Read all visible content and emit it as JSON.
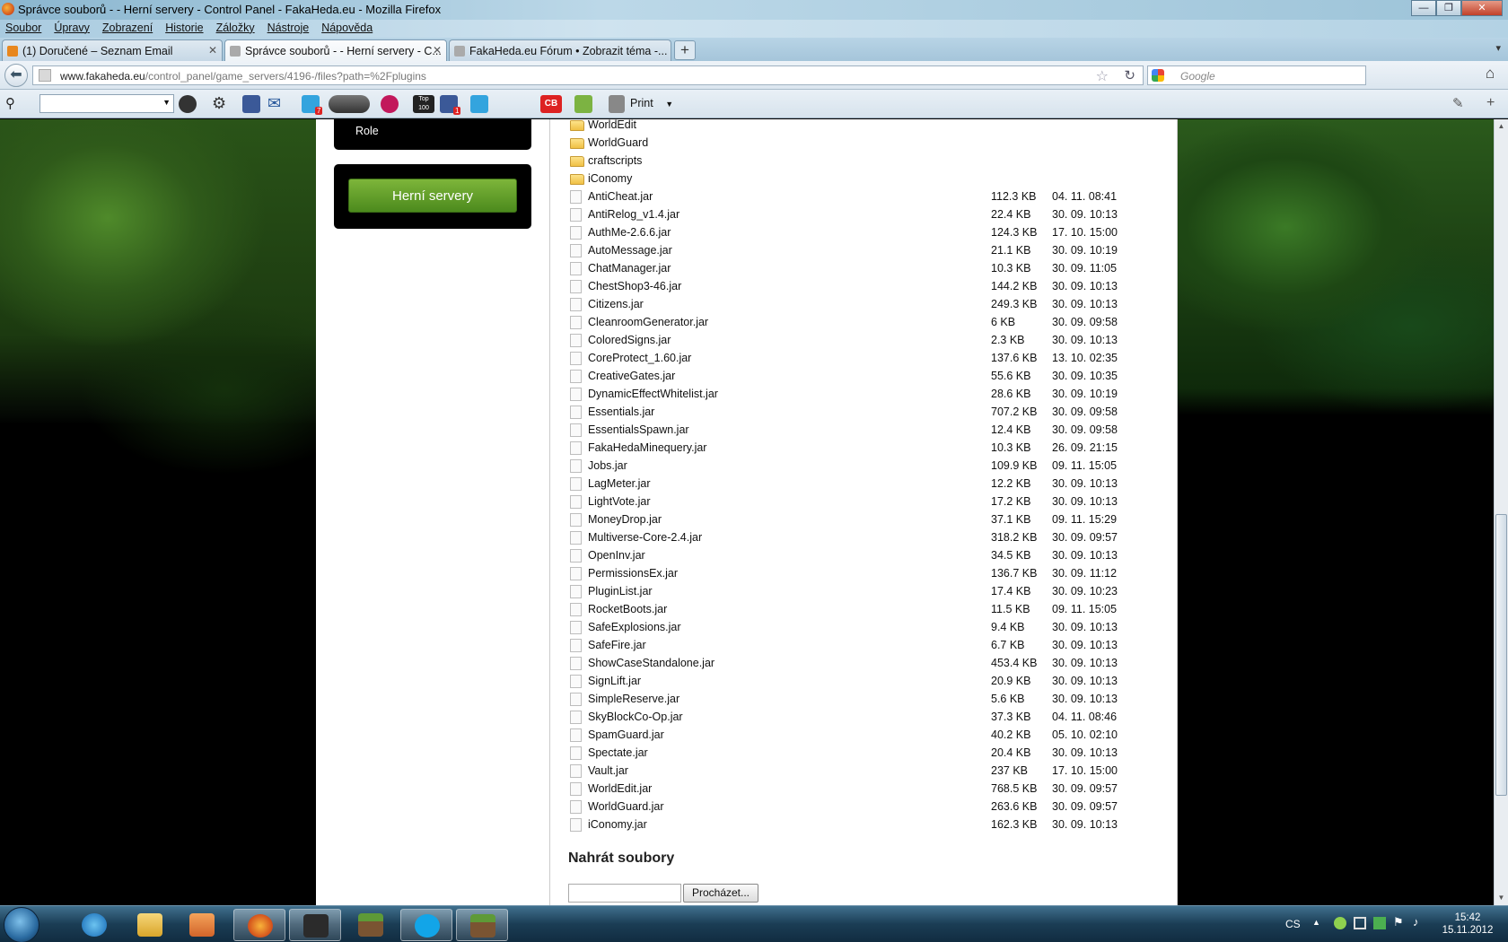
{
  "window": {
    "title": "Správce souborů - - Herní servery - Control Panel - FakaHeda.eu - Mozilla Firefox",
    "buttons": {
      "minimize": "—",
      "maximize": "❐",
      "close": "✕"
    }
  },
  "menu": [
    "Soubor",
    "Úpravy",
    "Zobrazení",
    "Historie",
    "Záložky",
    "Nástroje",
    "Nápověda"
  ],
  "tabs": [
    {
      "label": "(1) Doručené – Seznam Email",
      "active": false
    },
    {
      "label": "Správce souborů - - Herní servery - C...",
      "active": true
    },
    {
      "label": "FakaHeda.eu Fórum • Zobrazit téma -...",
      "active": false
    }
  ],
  "tabs_new": "+",
  "tabs_list": "▾",
  "nav": {
    "url_host": "www.fakaheda.eu",
    "url_path": "/control_panel/game_servers/4196-/files?path=%2Fplugins",
    "search_placeholder": "Google",
    "back": "⬅"
  },
  "toolbar2": {
    "print_label": "Print",
    "badges": {
      "twitter": "7",
      "top": "Top 100",
      "facebook": "1"
    }
  },
  "sidebar": {
    "role_label": "Role",
    "game_servers_button": "Herní servery"
  },
  "files": {
    "folders": [
      "WorldEdit",
      "WorldGuard",
      "craftscripts",
      "iConomy"
    ],
    "items": [
      {
        "name": "AntiCheat.jar",
        "size": "112.3 KB",
        "date": "04. 11. 08:41"
      },
      {
        "name": "AntiRelog_v1.4.jar",
        "size": "22.4 KB",
        "date": "30. 09. 10:13"
      },
      {
        "name": "AuthMe-2.6.6.jar",
        "size": "124.3 KB",
        "date": "17. 10. 15:00"
      },
      {
        "name": "AutoMessage.jar",
        "size": "21.1 KB",
        "date": "30. 09. 10:19"
      },
      {
        "name": "ChatManager.jar",
        "size": "10.3 KB",
        "date": "30. 09. 11:05"
      },
      {
        "name": "ChestShop3-46.jar",
        "size": "144.2 KB",
        "date": "30. 09. 10:13"
      },
      {
        "name": "Citizens.jar",
        "size": "249.3 KB",
        "date": "30. 09. 10:13"
      },
      {
        "name": "CleanroomGenerator.jar",
        "size": "6 KB",
        "date": "30. 09. 09:58"
      },
      {
        "name": "ColoredSigns.jar",
        "size": "2.3 KB",
        "date": "30. 09. 10:13"
      },
      {
        "name": "CoreProtect_1.60.jar",
        "size": "137.6 KB",
        "date": "13. 10. 02:35"
      },
      {
        "name": "CreativeGates.jar",
        "size": "55.6 KB",
        "date": "30. 09. 10:35"
      },
      {
        "name": "DynamicEffectWhitelist.jar",
        "size": "28.6 KB",
        "date": "30. 09. 10:19"
      },
      {
        "name": "Essentials.jar",
        "size": "707.2 KB",
        "date": "30. 09. 09:58"
      },
      {
        "name": "EssentialsSpawn.jar",
        "size": "12.4 KB",
        "date": "30. 09. 09:58"
      },
      {
        "name": "FakaHedaMinequery.jar",
        "size": "10.3 KB",
        "date": "26. 09. 21:15"
      },
      {
        "name": "Jobs.jar",
        "size": "109.9 KB",
        "date": "09. 11. 15:05"
      },
      {
        "name": "LagMeter.jar",
        "size": "12.2 KB",
        "date": "30. 09. 10:13"
      },
      {
        "name": "LightVote.jar",
        "size": "17.2 KB",
        "date": "30. 09. 10:13"
      },
      {
        "name": "MoneyDrop.jar",
        "size": "37.1 KB",
        "date": "09. 11. 15:29"
      },
      {
        "name": "Multiverse-Core-2.4.jar",
        "size": "318.2 KB",
        "date": "30. 09. 09:57"
      },
      {
        "name": "OpenInv.jar",
        "size": "34.5 KB",
        "date": "30. 09. 10:13"
      },
      {
        "name": "PermissionsEx.jar",
        "size": "136.7 KB",
        "date": "30. 09. 11:12"
      },
      {
        "name": "PluginList.jar",
        "size": "17.4 KB",
        "date": "30. 09. 10:23"
      },
      {
        "name": "RocketBoots.jar",
        "size": "11.5 KB",
        "date": "09. 11. 15:05"
      },
      {
        "name": "SafeExplosions.jar",
        "size": "9.4 KB",
        "date": "30. 09. 10:13"
      },
      {
        "name": "SafeFire.jar",
        "size": "6.7 KB",
        "date": "30. 09. 10:13"
      },
      {
        "name": "ShowCaseStandalone.jar",
        "size": "453.4 KB",
        "date": "30. 09. 10:13"
      },
      {
        "name": "SignLift.jar",
        "size": "20.9 KB",
        "date": "30. 09. 10:13"
      },
      {
        "name": "SimpleReserve.jar",
        "size": "5.6 KB",
        "date": "30. 09. 10:13"
      },
      {
        "name": "SkyBlockCo-Op.jar",
        "size": "37.3 KB",
        "date": "04. 11. 08:46"
      },
      {
        "name": "SpamGuard.jar",
        "size": "40.2 KB",
        "date": "05. 10. 02:10"
      },
      {
        "name": "Spectate.jar",
        "size": "20.4 KB",
        "date": "30. 09. 10:13"
      },
      {
        "name": "Vault.jar",
        "size": "237 KB",
        "date": "17. 10. 15:00"
      },
      {
        "name": "WorldEdit.jar",
        "size": "768.5 KB",
        "date": "30. 09. 09:57"
      },
      {
        "name": "WorldGuard.jar",
        "size": "263.6 KB",
        "date": "30. 09. 09:57"
      },
      {
        "name": "iConomy.jar",
        "size": "162.3 KB",
        "date": "30. 09. 10:13"
      }
    ]
  },
  "upload": {
    "heading": "Nahrát soubory",
    "browse_button": "Procházet..."
  },
  "taskbar": {
    "lang": "CS",
    "time": "15:42",
    "date": "15.11.2012"
  },
  "colors": {
    "accent_green": "#5b9a25",
    "firefox_orange": "#e8871e"
  }
}
